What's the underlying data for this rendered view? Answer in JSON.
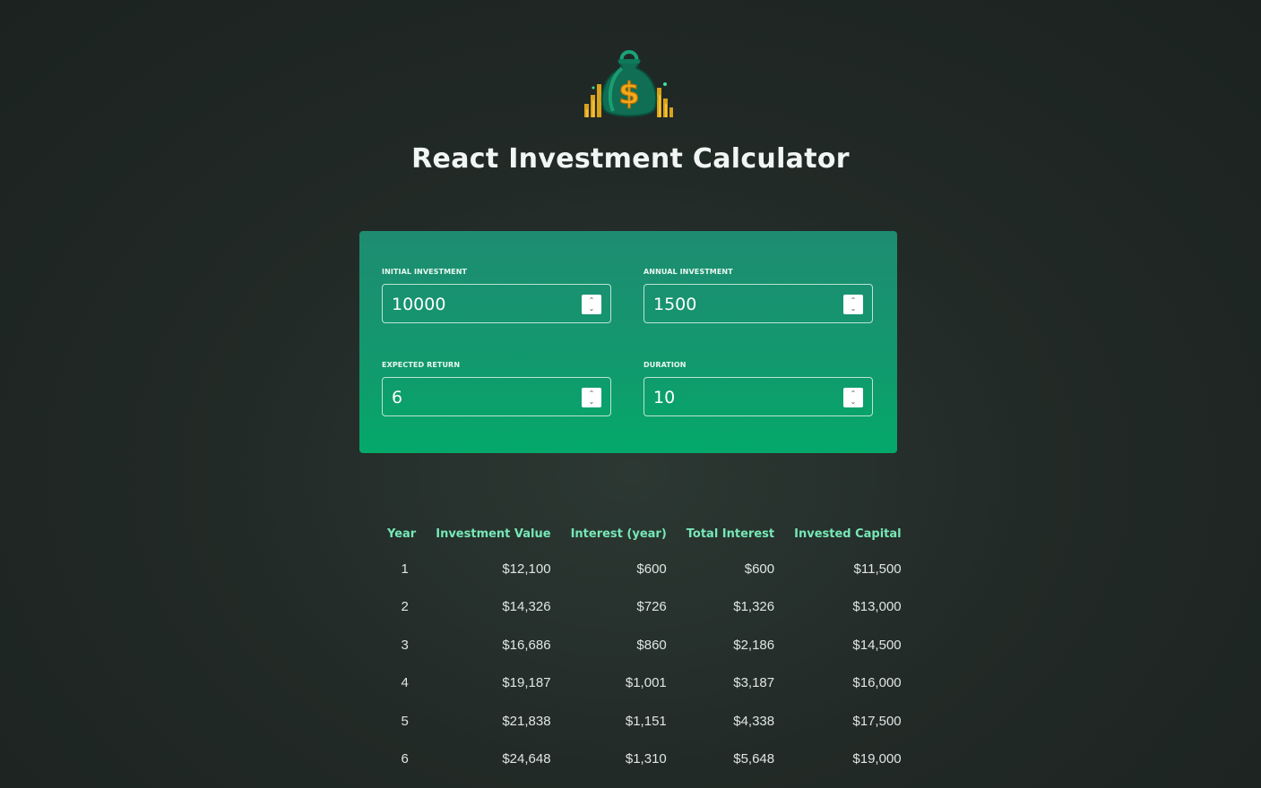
{
  "app": {
    "title": "React Investment Calculator"
  },
  "logo": {
    "icon": "money-bag-dollar-icon"
  },
  "inputs": {
    "initial_investment": {
      "label": "INITIAL INVESTMENT",
      "value": "10000"
    },
    "annual_investment": {
      "label": "ANNUAL INVESTMENT",
      "value": "1500"
    },
    "expected_return": {
      "label": "EXPECTED RETURN",
      "value": "6"
    },
    "duration": {
      "label": "DURATION",
      "value": "10"
    }
  },
  "table": {
    "headers": [
      "Year",
      "Investment Value",
      "Interest (year)",
      "Total Interest",
      "Invested Capital"
    ],
    "rows": [
      [
        "1",
        "$12,100",
        "$600",
        "$600",
        "$11,500"
      ],
      [
        "2",
        "$14,326",
        "$726",
        "$1,326",
        "$13,000"
      ],
      [
        "3",
        "$16,686",
        "$860",
        "$2,186",
        "$14,500"
      ],
      [
        "4",
        "$19,187",
        "$1,001",
        "$3,187",
        "$16,000"
      ],
      [
        "5",
        "$21,838",
        "$1,151",
        "$4,338",
        "$17,500"
      ],
      [
        "6",
        "$24,648",
        "$1,310",
        "$5,648",
        "$19,000"
      ]
    ]
  },
  "colors": {
    "background": "#222a27",
    "panel_top": "#1e8c72",
    "panel_bottom": "#03a96a",
    "header_accent": "#76e8b7"
  }
}
